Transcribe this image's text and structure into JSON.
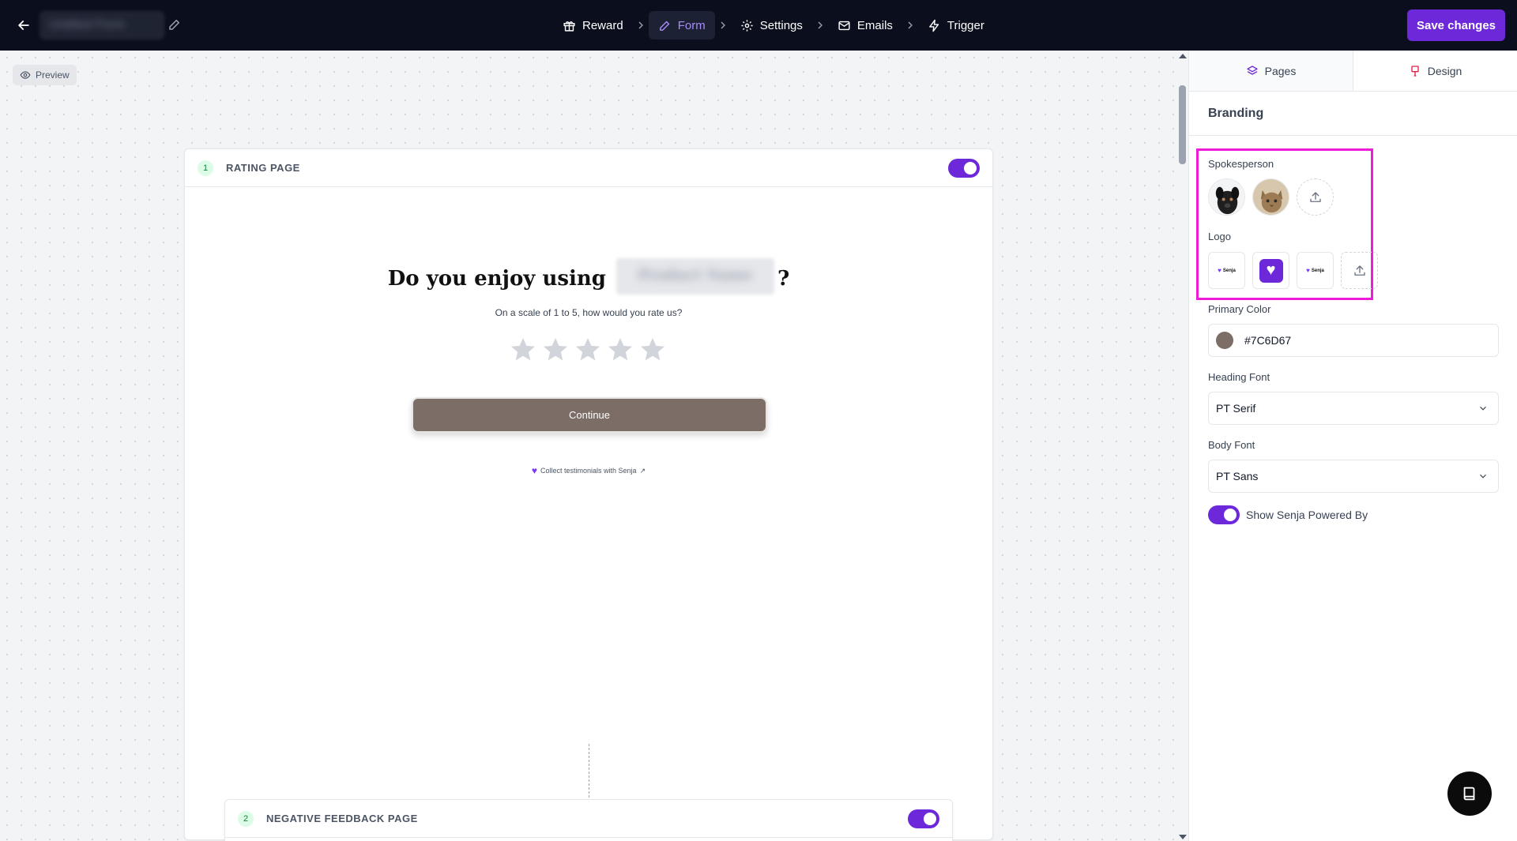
{
  "header": {
    "project_title": "Untitled Form",
    "save_label": "Save changes",
    "steps": [
      {
        "label": "Reward",
        "icon": "gift-icon"
      },
      {
        "label": "Form",
        "icon": "pencil-icon"
      },
      {
        "label": "Settings",
        "icon": "gear-icon"
      },
      {
        "label": "Emails",
        "icon": "mail-icon"
      },
      {
        "label": "Trigger",
        "icon": "bolt-icon"
      }
    ],
    "active_step": "Form"
  },
  "canvas": {
    "preview_label": "Preview",
    "pages": [
      {
        "number": "1",
        "title": "RATING PAGE",
        "enabled": true
      },
      {
        "number": "2",
        "title": "NEGATIVE FEEDBACK PAGE",
        "enabled": true
      }
    ],
    "rating_page": {
      "heading_prefix": "Do you enjoy using",
      "heading_blurred": "Product Name",
      "heading_suffix": "?",
      "subtitle": "On a scale of 1 to 5, how would you rate us?",
      "star_count": 5,
      "continue_label": "Continue",
      "powered_text": "Collect testimonials with Senja",
      "powered_arrow": "↗"
    }
  },
  "panel": {
    "tabs": [
      {
        "label": "Pages",
        "icon": "layers-icon",
        "active": true
      },
      {
        "label": "Design",
        "icon": "paint-icon",
        "active": false
      }
    ],
    "section_title": "Branding",
    "spokesperson_label": "Spokesperson",
    "logo_label": "Logo",
    "logo_mark_text": "Senja",
    "primary_color_label": "Primary Color",
    "primary_color_value": "#7C6D67",
    "heading_font_label": "Heading Font",
    "heading_font_value": "PT Serif",
    "body_font_label": "Body Font",
    "body_font_value": "PT Sans",
    "powered_toggle_label": "Show Senja Powered By",
    "powered_toggle_on": true
  },
  "colors": {
    "accent": "#6d28d9",
    "highlight": "#ec1cd9",
    "primary": "#7C6D67"
  }
}
